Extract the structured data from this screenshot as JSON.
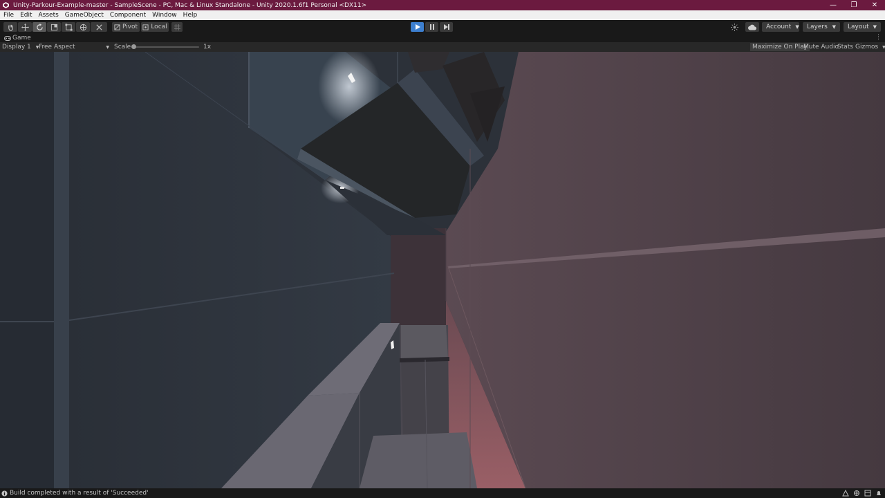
{
  "window": {
    "title": "Unity-Parkour-Example-master - SampleScene - PC, Mac & Linux Standalone - Unity 2020.1.6f1 Personal <DX11>",
    "minimize_glyph": "—",
    "restore_glyph": "❐",
    "close_glyph": "✕"
  },
  "menu": [
    "File",
    "Edit",
    "Assets",
    "GameObject",
    "Component",
    "Window",
    "Help"
  ],
  "toolbar": {
    "pivot_label": "Pivot",
    "local_label": "Local",
    "account_label": "Account",
    "layers_label": "Layers",
    "layout_label": "Layout"
  },
  "game_view": {
    "tab_label": "Game",
    "display_label": "Display 1",
    "aspect_label": "Free Aspect",
    "scale_label": "Scale",
    "scale_value": "1x",
    "maximize_label": "Maximize On Play",
    "mute_label": "Mute Audio",
    "stats_label": "Stats",
    "gizmos_label": "Gizmos"
  },
  "status": {
    "message": "Build completed with a result of 'Succeeded'"
  },
  "colors": {
    "title_bar": "#6b1a3f",
    "play_active": "#3d7fcf"
  }
}
